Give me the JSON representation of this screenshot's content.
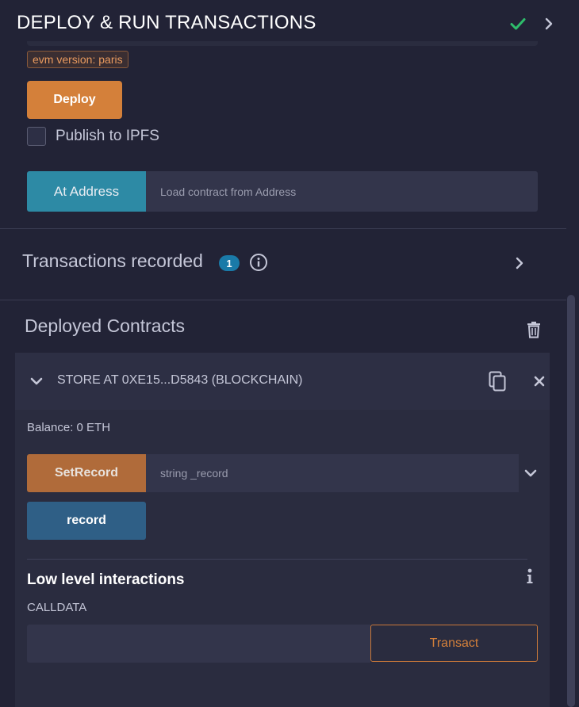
{
  "header": {
    "title": "DEPLOY & RUN TRANSACTIONS",
    "status_icon": "check-icon",
    "status_color": "#2ebd6b",
    "expand_icon": "chevron-right-icon"
  },
  "deploy": {
    "evm_badge": "evm version: paris",
    "deploy_label": "Deploy",
    "publish_ipfs_label": "Publish to IPFS",
    "publish_ipfs_checked": false,
    "at_address_label": "At Address",
    "at_address_placeholder": "Load contract from Address",
    "accent_color": "#d4803a"
  },
  "transactions": {
    "title": "Transactions recorded",
    "count": "1",
    "info_icon": "info-circle-icon",
    "expand_icon": "chevron-right-icon"
  },
  "deployed": {
    "title": "Deployed Contracts",
    "trash_icon": "trash-icon",
    "contract": {
      "name": "STORE AT 0XE15...D5843 (BLOCKCHAIN)",
      "balance": "Balance: 0 ETH",
      "functions": [
        {
          "label": "SetRecord",
          "placeholder": "string _record",
          "kind": "transact"
        },
        {
          "label": "record",
          "kind": "call"
        }
      ],
      "low_level": {
        "title": "Low level interactions",
        "calldata_label": "CALLDATA",
        "calldata_value": "",
        "transact_label": "Transact"
      }
    }
  }
}
